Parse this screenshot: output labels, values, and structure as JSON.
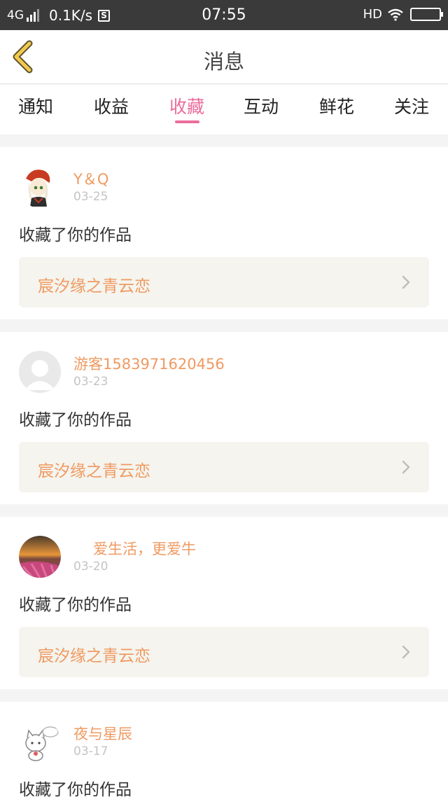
{
  "status_bar": {
    "network": "4G",
    "speed": "0.1K/s",
    "app_badge": "S",
    "time": "07:55",
    "hd": "HD"
  },
  "header": {
    "title": "消息"
  },
  "tabs": [
    {
      "label": "通知"
    },
    {
      "label": "收益"
    },
    {
      "label": "收藏",
      "active": true
    },
    {
      "label": "互动"
    },
    {
      "label": "鲜花"
    },
    {
      "label": "关注"
    }
  ],
  "messages": [
    {
      "name": "Y＆Q",
      "date": "03-25",
      "action": "收藏了你的作品",
      "work": "宸汐缘之青云恋"
    },
    {
      "name": "游客1583971620456",
      "date": "03-23",
      "action": "收藏了你的作品",
      "work": "宸汐缘之青云恋"
    },
    {
      "name": "爱生活，更爱牛",
      "date": "03-20",
      "action": "收藏了你的作品",
      "work": "宸汐缘之青云恋"
    },
    {
      "name": "夜与星辰",
      "date": "03-17",
      "action": "收藏了你的作品",
      "work": ""
    }
  ],
  "colors": {
    "accent_pink": "#ec6c9c",
    "name_orange": "#ef9a61",
    "back_yellow": "#f2c94c",
    "card_bg": "#f5f4ee"
  },
  "icons": {
    "back": "chevron-left-icon",
    "card_arrow": "chevron-right-icon"
  }
}
